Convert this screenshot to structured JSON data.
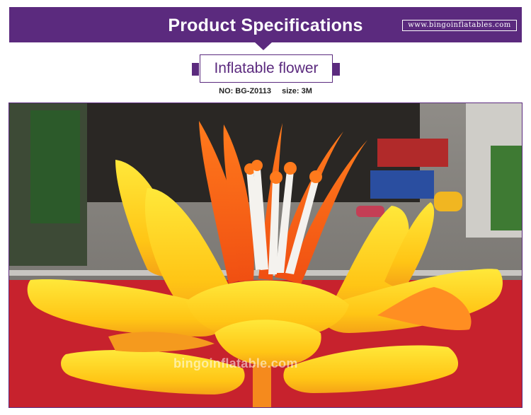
{
  "header": {
    "title": "Product Specifications",
    "site_url": "www.bingoinflatables.com",
    "accent_color": "#5b2a7e"
  },
  "product": {
    "name": "Inflatable flower",
    "no_label": "NO:",
    "no_value": "BG-Z0113",
    "size_label": "size:",
    "size_value": "3M"
  },
  "photo": {
    "watermark": "bingoinflatable.com",
    "subject": "inflatable-flower-photo"
  }
}
